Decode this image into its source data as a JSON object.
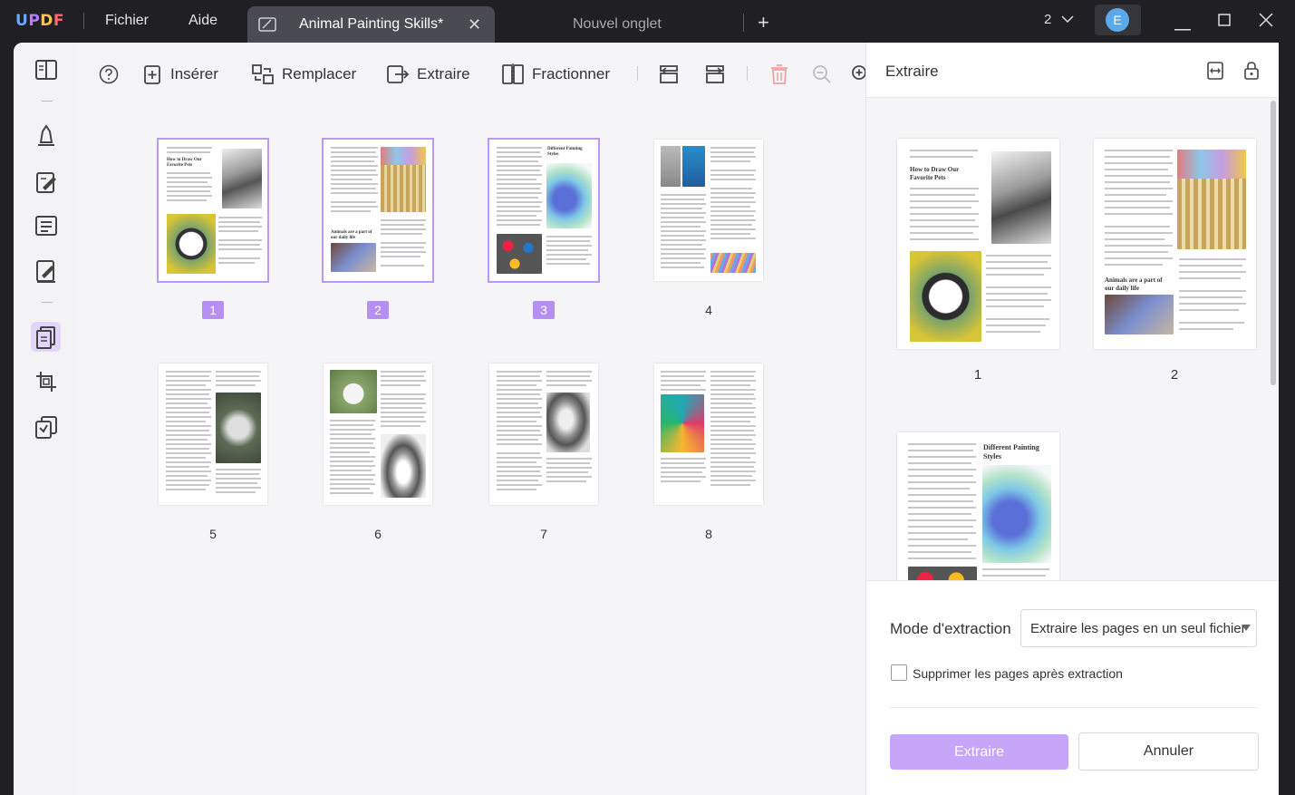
{
  "app": {
    "logo": "UPDF"
  },
  "menu": {
    "file": "Fichier",
    "help": "Aide"
  },
  "tabs": {
    "active_title": "Animal Painting Skills*",
    "new_tab": "Nouvel onglet"
  },
  "window": {
    "count": "2",
    "avatar_initial": "E"
  },
  "toolbar": {
    "insert": "Insérer",
    "replace": "Remplacer",
    "extract": "Extraire",
    "split": "Fractionner"
  },
  "pages": [
    {
      "num": "1",
      "selected": true
    },
    {
      "num": "2",
      "selected": true
    },
    {
      "num": "3",
      "selected": true
    },
    {
      "num": "4",
      "selected": false
    },
    {
      "num": "5",
      "selected": false
    },
    {
      "num": "6",
      "selected": false
    },
    {
      "num": "7",
      "selected": false
    },
    {
      "num": "8",
      "selected": false
    }
  ],
  "thumb_text": {
    "p1_heading": "How to Draw Our Favorite Pets",
    "p2_heading": "Animals are a part of our daily life",
    "p3_heading": "Different Painting Styles"
  },
  "panel": {
    "title": "Extraire",
    "preview_nums": [
      "1",
      "2"
    ],
    "mode_label": "Mode d'extraction",
    "mode_value": "Extraire les pages en un seul fichier",
    "delete_label": "Supprimer les pages après extraction",
    "extract_button": "Extraire",
    "cancel_button": "Annuler"
  },
  "colors": {
    "accent": "#b68ff3",
    "extract_btn": "#c7a5f8",
    "titlebar": "#1f1f24"
  }
}
